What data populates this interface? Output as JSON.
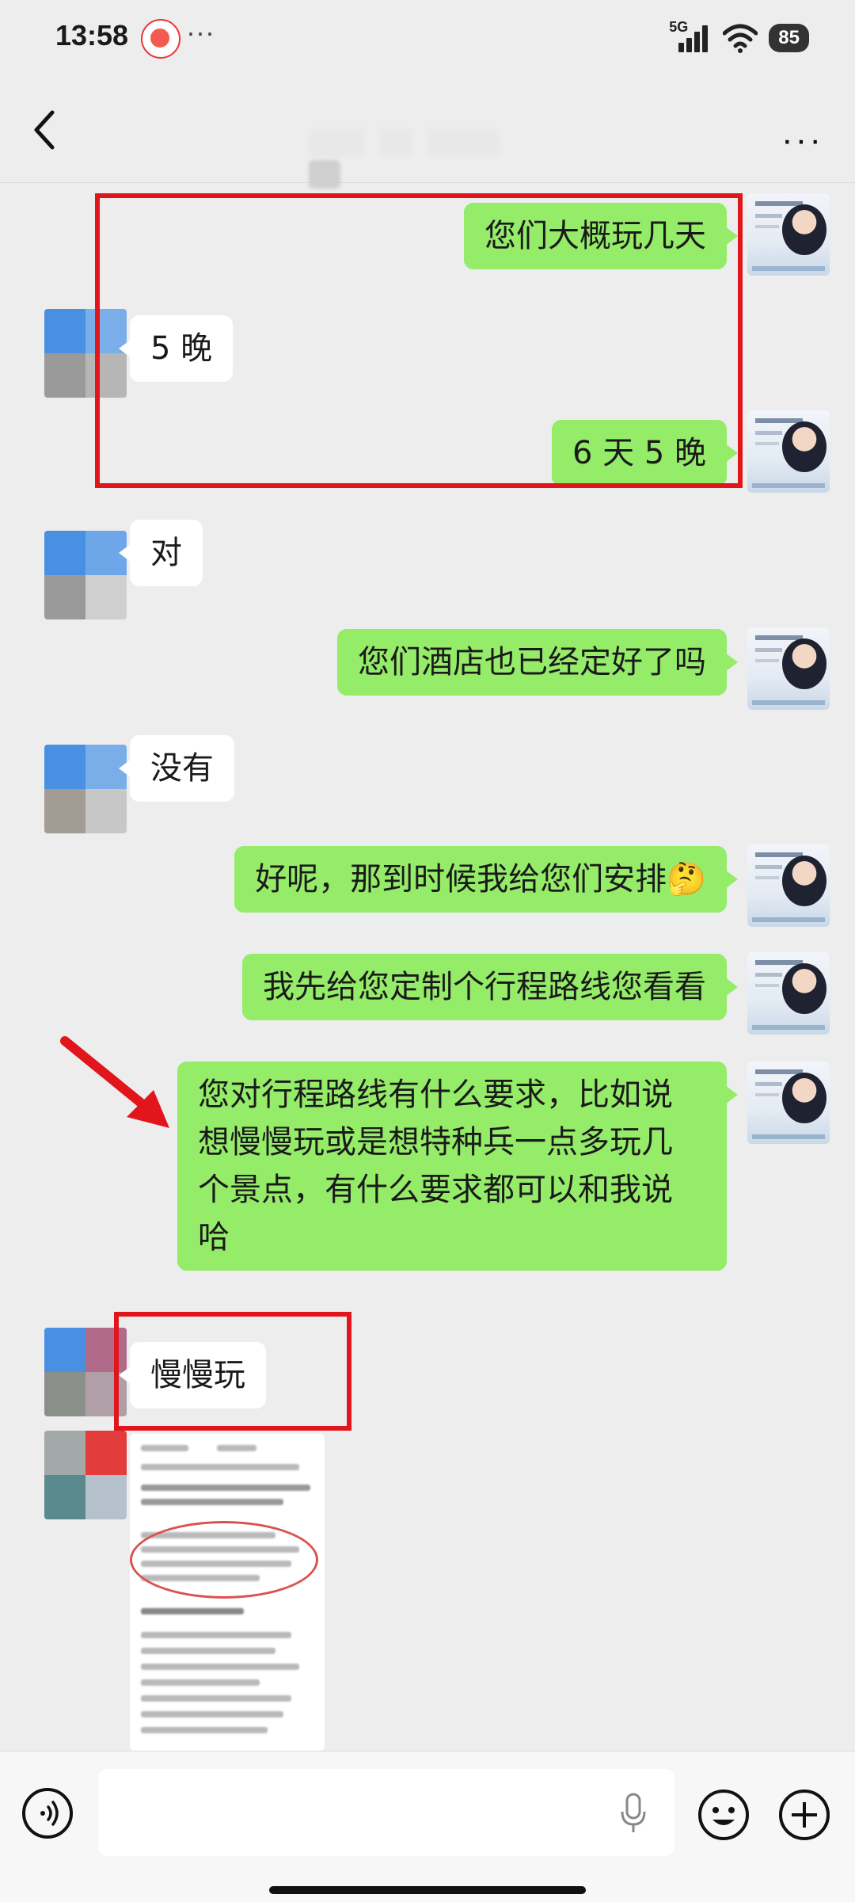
{
  "status": {
    "time": "13:58",
    "dots": "···",
    "network": "5G",
    "battery": "85"
  },
  "header": {
    "back_icon": "chevron-left-icon",
    "more": "···"
  },
  "messages": [
    {
      "side": "me",
      "text": "您们大概玩几天"
    },
    {
      "side": "them",
      "text": "5 晚"
    },
    {
      "side": "me",
      "text": "6 天 5 晚"
    },
    {
      "side": "them",
      "text": "对"
    },
    {
      "side": "me",
      "text": "您们酒店也已经定好了吗"
    },
    {
      "side": "them",
      "text": "没有"
    },
    {
      "side": "me",
      "text": "好呢，那到时候我给您们安排"
    },
    {
      "side": "me",
      "text": "我先给您定制个行程路线您看看"
    },
    {
      "side": "me",
      "lines": [
        "您对行程路线有什么要求，比如说",
        "想慢慢玩或是想特种兵一点多玩几",
        "个景点，有什么要求都可以和我说",
        "哈"
      ]
    },
    {
      "side": "them",
      "text": "慢慢玩"
    },
    {
      "side": "them",
      "type": "image",
      "description": "blurred screenshot"
    }
  ],
  "emoji": "🤔",
  "colors": {
    "bg": "#ededed",
    "my_bubble": "#95ec69",
    "their_bubble": "#ffffff",
    "highlight": "#e0161c"
  },
  "input": {
    "voice_icon": "voice-icon",
    "mic_icon": "mic-icon",
    "emoji_icon": "emoji-icon",
    "plus_icon": "plus-icon"
  }
}
